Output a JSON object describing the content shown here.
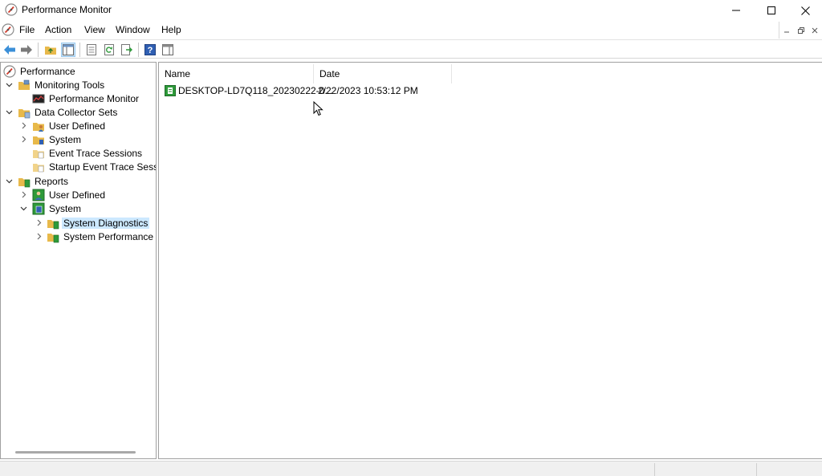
{
  "window": {
    "title": "Performance Monitor",
    "app_icon": "perfmon-icon"
  },
  "menu": {
    "items": [
      "File",
      "Action",
      "View",
      "Window",
      "Help"
    ]
  },
  "toolbar": {
    "buttons": [
      "back-arrow-icon",
      "forward-arrow-icon",
      "up-folder-icon",
      "show-hide-console-tree-icon",
      "properties-icon",
      "refresh-icon",
      "export-list-icon",
      "help-icon",
      "show-hide-action-pane-icon"
    ]
  },
  "tree": {
    "root": "Performance",
    "monitoring_tools": "Monitoring Tools",
    "performance_monitor": "Performance Monitor",
    "data_collector_sets": "Data Collector Sets",
    "dcs_user_defined": "User Defined",
    "dcs_system": "System",
    "event_trace_sessions": "Event Trace Sessions",
    "startup_event_trace_sessions": "Startup Event Trace Sessior",
    "reports": "Reports",
    "rep_user_defined": "User Defined",
    "rep_system": "System",
    "system_diagnostics": "System Diagnostics",
    "system_performance": "System Performance"
  },
  "list": {
    "columns": [
      "Name",
      "Date"
    ],
    "rows": [
      {
        "name": "DESKTOP-LD7Q118_20230222-0...",
        "date": "2/22/2023 10:53:12 PM"
      }
    ]
  },
  "colors": {
    "selection": "#cce8ff",
    "folder": "#e8b94a",
    "report_green": "#2e9a3a"
  }
}
